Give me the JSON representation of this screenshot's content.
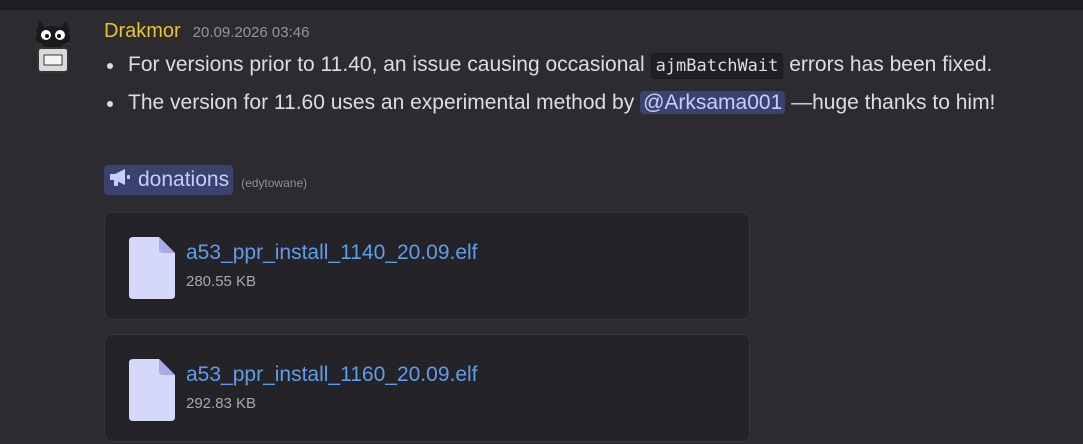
{
  "message": {
    "author": "Drakmor",
    "timestamp": "20.09.2026 03:46",
    "bullets": [
      {
        "before": "For versions prior to 11.40, an issue causing occasional ",
        "code": "ajmBatchWait",
        "after": " errors has been fixed."
      },
      {
        "before": "The version for 11.60 uses an experimental method by ",
        "mention": "@Arksama001",
        "after": " —huge thanks to him!"
      }
    ],
    "channel": {
      "icon": "megaphone-icon",
      "name": "donations",
      "edited": "(edytowane)"
    },
    "attachments": [
      {
        "name": "a53_ppr_install_1140_20.09.elf",
        "size": "280.55 KB"
      },
      {
        "name": "a53_ppr_install_1160_20.09.elf",
        "size": "292.83 KB"
      }
    ]
  },
  "colors": {
    "background": "#2b2b30",
    "author": "#e8c431",
    "link": "#5f9dea",
    "mention_bg": "#3c4270",
    "mention_text": "#c9cdfb"
  }
}
